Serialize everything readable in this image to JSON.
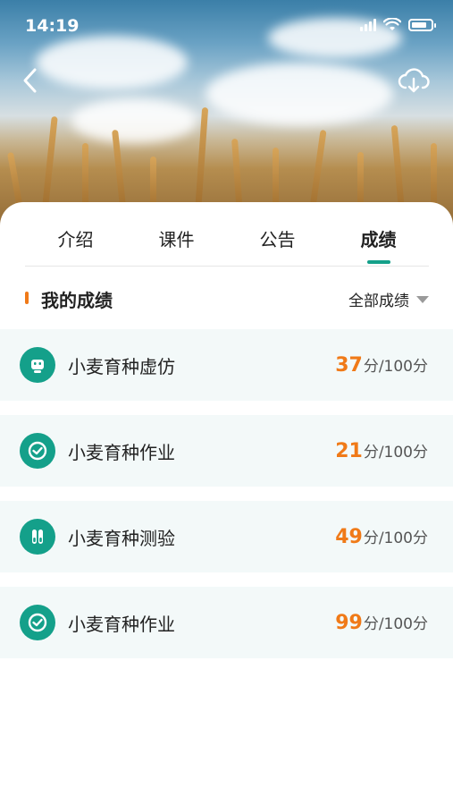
{
  "status": {
    "time": "14:19"
  },
  "tabs": [
    {
      "label": "介绍"
    },
    {
      "label": "课件"
    },
    {
      "label": "公告"
    },
    {
      "label": "成绩"
    }
  ],
  "section": {
    "title": "我的成绩",
    "filter": "全部成绩"
  },
  "scores": [
    {
      "icon": "robot-icon",
      "title": "小麦育种虚仿",
      "score": "37",
      "unit": "分",
      "total": "/100分"
    },
    {
      "icon": "check-circle-icon",
      "title": "小麦育种作业",
      "score": "21",
      "unit": "分",
      "total": "/100分"
    },
    {
      "icon": "test-tubes-icon",
      "title": "小麦育种测验",
      "score": "49",
      "unit": "分",
      "total": "/100分"
    },
    {
      "icon": "check-circle-icon",
      "title": "小麦育种作业",
      "score": "99",
      "unit": "分",
      "total": "/100分"
    }
  ],
  "colors": {
    "accent": "#14a08a",
    "score": "#f07a18"
  }
}
